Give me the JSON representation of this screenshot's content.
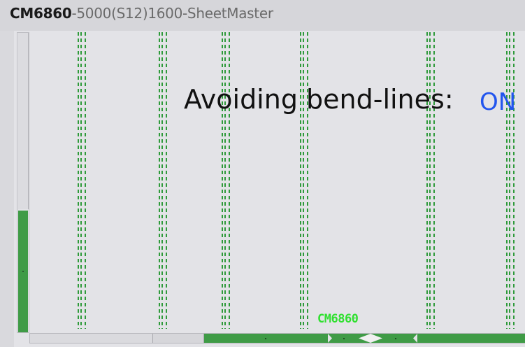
{
  "window": {
    "title_prefix": "CM6860",
    "title_suffix": "-5000(S12)1600-SheetMaster"
  },
  "canvas": {
    "status_label": "Avoiding bend-lines:",
    "status_value": "ON",
    "part_label": "CM6860"
  },
  "colors": {
    "bend_line": "#2e9a3a",
    "scroll_fill": "#3f9b46",
    "status_value": "#2255ee",
    "part_label": "#2fe02f"
  }
}
